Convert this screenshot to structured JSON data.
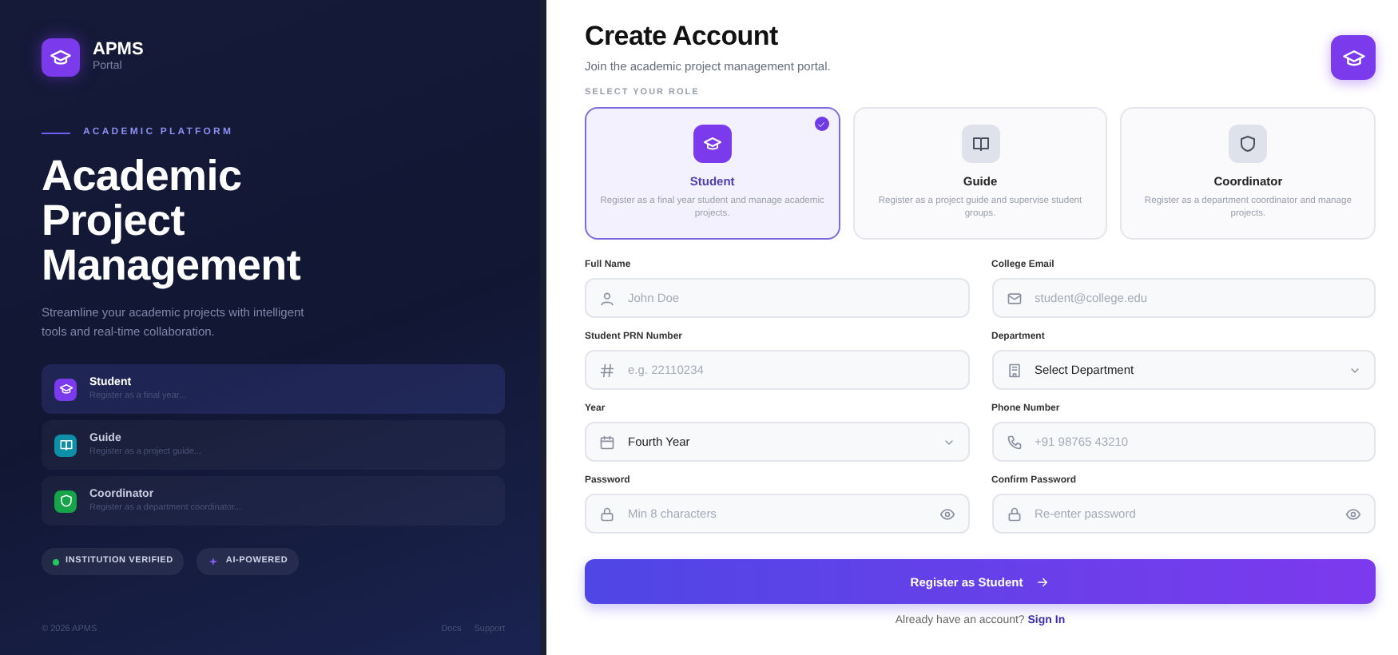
{
  "brand": {
    "name": "APMS",
    "subtitle": "Portal"
  },
  "hero": {
    "eyebrow": "ACADEMIC PLATFORM",
    "title_lines": [
      "Academic",
      "Project",
      "Management"
    ],
    "description": "Streamline your academic projects with intelligent tools and real-time collaboration."
  },
  "side_roles": [
    {
      "title": "Student",
      "text": "Register as a final year...",
      "color": "#7c3aed",
      "selected": true
    },
    {
      "title": "Guide",
      "text": "Register as a project guide...",
      "color": "#0e8fa8",
      "selected": false
    },
    {
      "title": "Coordinator",
      "text": "Register as a department coordinator...",
      "color": "#16a34a",
      "selected": false
    }
  ],
  "badges": [
    {
      "label": "INSTITUTION VERIFIED",
      "color": "#22c55e"
    },
    {
      "label": "AI-POWERED",
      "color": "#8b5cf6"
    }
  ],
  "footer": {
    "copyright": "© 2026 APMS",
    "links": [
      "Docs",
      "Support"
    ]
  },
  "form": {
    "title": "Create Account",
    "subtitle": "Join the academic project management portal.",
    "role_heading": "SELECT YOUR ROLE",
    "roles": [
      {
        "title": "Student",
        "text": "Register as a final year student and manage academic projects.",
        "selected": true
      },
      {
        "title": "Guide",
        "text": "Register as a project guide and supervise student groups.",
        "selected": false
      },
      {
        "title": "Coordinator",
        "text": "Register as a department coordinator and manage projects.",
        "selected": false
      }
    ],
    "fields": [
      {
        "label": "Full Name",
        "kind": "text",
        "placeholder": "John Doe"
      },
      {
        "label": "College Email",
        "kind": "text",
        "placeholder": "student@college.edu"
      },
      {
        "label": "Student PRN Number",
        "kind": "text",
        "placeholder": "e.g. 22110234"
      },
      {
        "label": "Department",
        "kind": "select",
        "value": "Select Department"
      },
      {
        "label": "Year",
        "kind": "select",
        "value": "Fourth Year"
      },
      {
        "label": "Phone Number",
        "kind": "text",
        "placeholder": "+91 98765 43210"
      },
      {
        "label": "Password",
        "kind": "password",
        "placeholder": "Min 8 characters"
      },
      {
        "label": "Confirm Password",
        "kind": "password",
        "placeholder": "Re-enter password"
      }
    ],
    "submit": "Register as Student",
    "signin_prompt": "Already have an account?",
    "signin_link": "Sign In"
  }
}
